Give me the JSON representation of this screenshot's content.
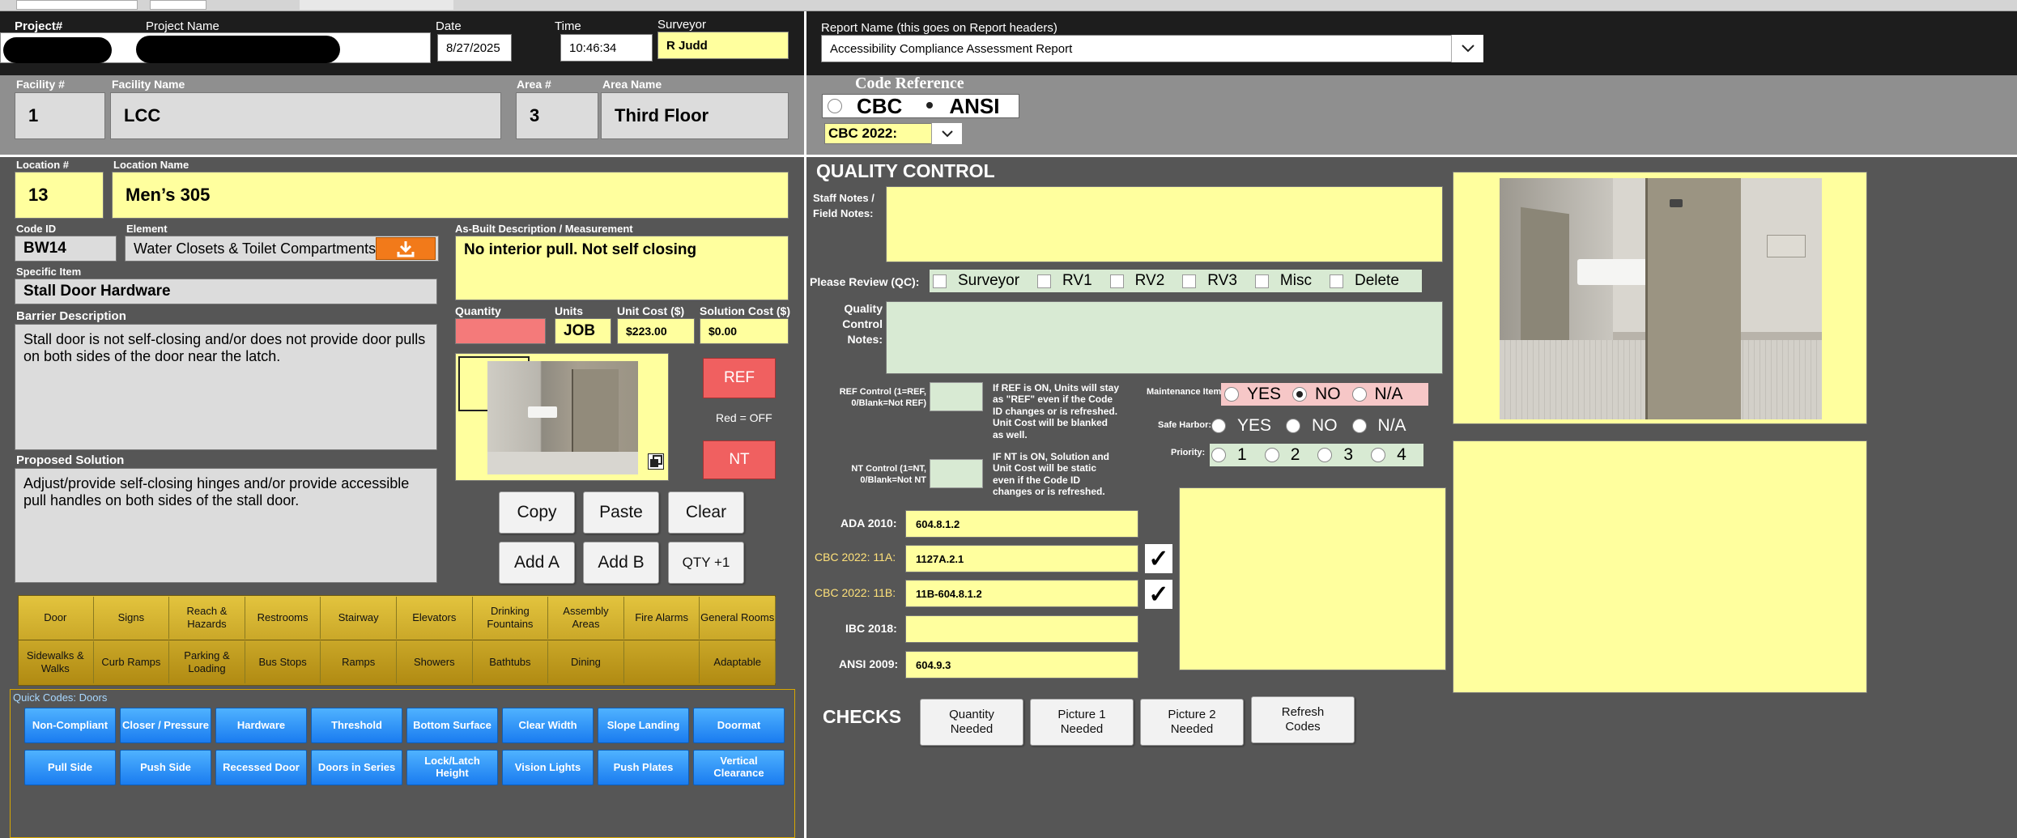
{
  "header": {
    "project_num_label": "Project#",
    "project_name_label": "Project Name",
    "date_label": "Date",
    "date_value": "8/27/2025",
    "time_label": "Time",
    "time_value": "10:46:34",
    "surveyor_label": "Surveyor",
    "surveyor_value": "R Judd",
    "report_name_label": "Report Name (this goes on Report headers)",
    "report_name_value": "Accessibility Compliance Assessment Report"
  },
  "facility": {
    "facility_num_label": "Facility #",
    "facility_num": "1",
    "facility_name_label": "Facility Name",
    "facility_name": "LCC",
    "area_num_label": "Area #",
    "area_num": "3",
    "area_name_label": "Area Name",
    "area_name": "Third Floor"
  },
  "code_reference": {
    "title": "Code Reference",
    "option_cbc": "CBC",
    "option_ansi": "ANSI",
    "selected": "ANSI",
    "version": "CBC 2022:"
  },
  "location": {
    "location_num_label": "Location #",
    "location_num": "13",
    "location_name_label": "Location Name",
    "location_name": "Men’s 305",
    "code_id_label": "Code ID",
    "code_id": "BW14",
    "element_label": "Element",
    "element": "Water Closets & Toilet Compartments",
    "specific_item_label": "Specific Item",
    "specific_item": "Stall Door Hardware",
    "barrier_label": "Barrier Description",
    "barrier": "Stall door is not self-closing and/or does not provide door pulls on both sides of the door near the latch.",
    "solution_label": "Proposed Solution",
    "solution": "Adjust/provide self-closing hinges and/or provide accessible pull handles on both sides of the stall door.",
    "asbuilt_label": "As-Built Description / Measurement",
    "asbuilt": "No interior pull. Not self closing"
  },
  "costs": {
    "quantity_label": "Quantity",
    "quantity": "",
    "units_label": "Units",
    "units": "JOB",
    "unit_cost_label": "Unit Cost ($)",
    "unit_cost": "$223.00",
    "solution_cost_label": "Solution Cost ($)",
    "solution_cost": "$0.00"
  },
  "toggles": {
    "ref": "REF",
    "red_off": "Red = OFF",
    "nt": "NT"
  },
  "actions": {
    "copy": "Copy",
    "paste": "Paste",
    "clear": "Clear",
    "add_a": "Add A",
    "add_b": "Add B",
    "qty_plus": "QTY +1"
  },
  "categories_row1": [
    "Door",
    "Signs",
    "Reach & Hazards",
    "Restrooms",
    "Stairway",
    "Elevators",
    "Drinking Fountains",
    "Assembly Areas",
    "Fire Alarms",
    "General Rooms"
  ],
  "categories_row2": [
    "Sidewalks & Walks",
    "Curb Ramps",
    "Parking & Loading",
    "Bus Stops",
    "Ramps",
    "Showers",
    "Bathtubs",
    "Dining",
    "",
    "Adaptable"
  ],
  "quick_codes": {
    "title": "Quick Codes: Doors",
    "row1": [
      "Non-Compliant",
      "Closer / Pressure",
      "Hardware",
      "Threshold",
      "Bottom Surface",
      "Clear Width",
      "Slope Landing",
      "Doormat"
    ],
    "row2": [
      "Pull Side",
      "Push Side",
      "Recessed Door",
      "Doors in Series",
      "Lock/Latch Height",
      "Vision Lights",
      "Push Plates",
      "Vertical Clearance"
    ]
  },
  "qc": {
    "title": "QUALITY CONTROL",
    "staff_notes_label": "Staff Notes / Field Notes:",
    "please_review_label": "Please Review (QC):",
    "review_options": [
      "Surveyor",
      "RV1",
      "RV2",
      "RV3",
      "Misc",
      "Delete"
    ],
    "qc_notes_label": "Quality Control Notes:",
    "ref_control_label": "REF Control (1=REF, 0/Blank=Not REF)",
    "ref_control_help": "If REF is ON, Units will stay as \"REF\" even if the Code ID changes or is refreshed. Unit Cost will be blanked as well.",
    "nt_control_label": "NT Control (1=NT, 0/Blank=Not NT",
    "nt_control_help": "IF NT is ON, Solution and Unit Cost will be static even if the Code ID changes or is refreshed.",
    "maintenance_label": "Maintenance Item:",
    "maintenance_options": [
      "YES",
      "NO",
      "N/A"
    ],
    "maintenance_selected": "NO",
    "safe_harbor_label": "Safe Harbor:",
    "safe_harbor_options": [
      "YES",
      "NO",
      "N/A"
    ],
    "priority_label": "Priority:",
    "priority_options": [
      "1",
      "2",
      "3",
      "4"
    ]
  },
  "codes": {
    "ada_label": "ADA 2010:",
    "ada_value": "604.8.1.2",
    "cbc11a_label": "CBC 2022:  11A:",
    "cbc11a_value": "1127A.2.1",
    "cbc11b_label": "CBC 2022:  11B:",
    "cbc11b_value": "11B-604.8.1.2",
    "ibc_label": "IBC 2018:",
    "ibc_value": "",
    "ansi_label": "ANSI 2009:",
    "ansi_value": "604.9.3",
    "checkmark": "✓"
  },
  "checks": {
    "title": "CHECKS",
    "quantity_needed": "Quantity Needed",
    "picture1_needed": "Picture 1 Needed",
    "picture2_needed": "Picture 2 Needed",
    "refresh_codes": "Refresh Codes"
  },
  "colors": {
    "dark_bg": "#1d1d1d",
    "mid_bg": "#8f8f8f",
    "panel_bg": "#565656",
    "yellow_field": "#ffff9e",
    "orange_button": "#f27a1a",
    "blue_button": "#1a7cf0"
  }
}
